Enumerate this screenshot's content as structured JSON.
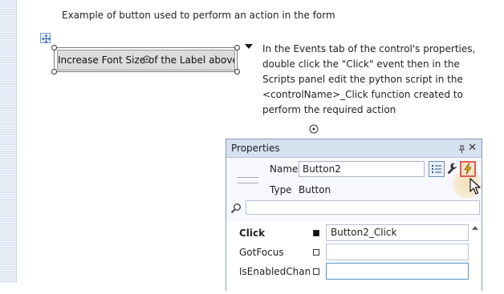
{
  "designer": {
    "caption": "Example of button used to perform an action in the form",
    "button_label": "Increase Font Size of the Label above",
    "instructions": [
      "In the Events tab of the control's properties,",
      "double click the \"Click\" event then in the",
      "Scripts panel edit the python script in the",
      "<controlName>_Click function created to",
      "perform the required action"
    ]
  },
  "properties": {
    "title": "Properties",
    "name_label": "Name",
    "name_value": "Button2",
    "type_label": "Type",
    "type_value": "Button",
    "search_value": "",
    "events": [
      {
        "name": "Click",
        "value": "Button2_Click",
        "bold": true,
        "has_handler": true
      },
      {
        "name": "GotFocus",
        "value": "",
        "bold": false,
        "has_handler": false
      },
      {
        "name": "IsEnabledChan...",
        "value": "",
        "bold": false,
        "has_handler": false
      }
    ],
    "icons": {
      "pin": "pin-icon",
      "close": "close-icon",
      "properties_tab": "list-icon",
      "wrench": "wrench-icon",
      "events_tab": "lightning-icon",
      "search": "search-icon"
    }
  },
  "colors": {
    "accent": "#6f8fc4",
    "events_highlight": "#e05a5a"
  }
}
